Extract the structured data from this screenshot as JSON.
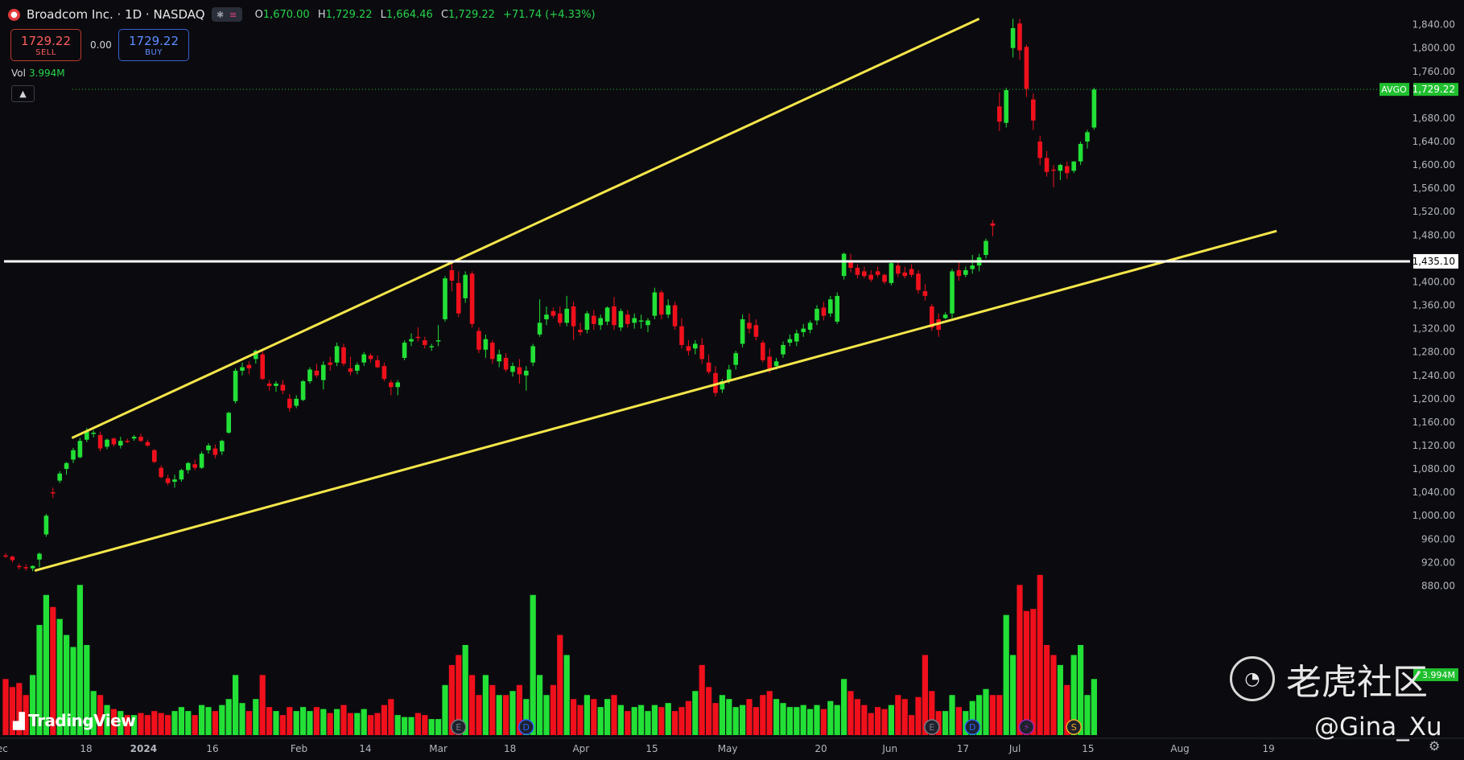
{
  "header": {
    "title": "Broadcom Inc. · 1D · NASDAQ",
    "logo_glyph": "●",
    "ohlc": [
      {
        "k": "O",
        "v": "1,670.00"
      },
      {
        "k": "H",
        "v": "1,729.22"
      },
      {
        "k": "L",
        "v": "1,664.46"
      },
      {
        "k": "C",
        "v": "1,729.22"
      }
    ],
    "change": "+71.74 (+4.33%)"
  },
  "trade": {
    "sell_price": "1729.22",
    "sell_label": "SELL",
    "spread": "0.00",
    "buy_price": "1729.22",
    "buy_label": "BUY"
  },
  "volume": {
    "label": "Vol",
    "value": "3.994M"
  },
  "branding": {
    "tradingview": "TradingView",
    "watermark": "老虎社区",
    "handle": "@Gina_Xu"
  },
  "colors": {
    "up": "#22e036",
    "down": "#f0101c",
    "trendline": "#f5e64a",
    "hline": "#ffffff",
    "price_tag": "#1fbf2e"
  },
  "chart_data": {
    "type": "candlestick",
    "symbol": "AVGO",
    "last_price": 1729.22,
    "last_price_label": "1,729.22",
    "horizontal_line": {
      "price": 1435.1,
      "label": "1,435.10"
    },
    "ylim": [
      860,
      1856
    ],
    "y_ticks": [
      880,
      920,
      960,
      1000,
      1040,
      1080,
      1120,
      1160,
      1200,
      1240,
      1280,
      1320,
      1360,
      1400,
      1480,
      1520,
      1560,
      1600,
      1640,
      1680,
      1760,
      1800,
      1840
    ],
    "y_tick_labels": [
      "880.00",
      "920.00",
      "960.00",
      "1,000.00",
      "1,040.00",
      "1,080.00",
      "1,120.00",
      "1,160.00",
      "1,200.00",
      "1,240.00",
      "1,280.00",
      "1,320.00",
      "1,360.00",
      "1,400.00",
      "1,480.00",
      "1,520.00",
      "1,560.00",
      "1,600.00",
      "1,640.00",
      "1,680.00",
      "1,760.00",
      "1,800.00",
      "1,840.00"
    ],
    "x_labels": [
      "ec",
      "18",
      "2024",
      "16",
      "Feb",
      "14",
      "Mar",
      "18",
      "Apr",
      "15",
      "May",
      "20",
      "Jun",
      "17",
      "Jul",
      "15",
      "Aug",
      "19"
    ],
    "x_label_bar_index": [
      -0.5,
      11.9,
      20.4,
      30.6,
      43.4,
      53.2,
      64.0,
      74.6,
      85.1,
      95.6,
      106.8,
      120.6,
      130.8,
      141.6,
      149.3,
      160.1,
      173.7,
      186.8
    ],
    "volume_tag": "3.994M",
    "event_markers": [
      {
        "label": "E",
        "bar": 67,
        "color": "#787b86"
      },
      {
        "label": "D",
        "bar": 77,
        "color": "#2962ff"
      },
      {
        "label": "E",
        "bar": 137,
        "color": "#787b86"
      },
      {
        "label": "D",
        "bar": 143,
        "color": "#2962ff"
      },
      {
        "label": "⚡",
        "bar": 151,
        "color": "#9c27b0"
      },
      {
        "label": "S",
        "bar": 158,
        "color": "#f5a623"
      }
    ],
    "trendlines": [
      {
        "name": "upper",
        "from": {
          "bar": 9.8,
          "price": 1133
        },
        "to": {
          "bar": 144,
          "price": 1850
        }
      },
      {
        "name": "lower",
        "from": {
          "bar": 4.3,
          "price": 906
        },
        "to": {
          "bar": 188,
          "price": 1487
        }
      }
    ],
    "candles": [
      [
        932,
        936,
        928,
        930,
        28
      ],
      [
        930,
        932,
        920,
        924,
        24
      ],
      [
        914,
        918,
        908,
        912,
        26
      ],
      [
        912,
        917,
        906,
        910,
        20
      ],
      [
        910,
        915,
        905,
        914,
        30
      ],
      [
        925,
        937,
        912,
        935,
        55
      ],
      [
        968,
        1003,
        964,
        1000,
        70
      ],
      [
        1040,
        1048,
        1030,
        1038,
        64
      ],
      [
        1060,
        1076,
        1056,
        1072,
        58
      ],
      [
        1080,
        1092,
        1070,
        1090,
        50
      ],
      [
        1096,
        1116,
        1090,
        1112,
        44
      ],
      [
        1100,
        1133,
        1098,
        1128,
        75
      ],
      [
        1130,
        1150,
        1126,
        1145,
        45
      ],
      [
        1140,
        1146,
        1134,
        1142,
        22
      ],
      [
        1138,
        1144,
        1110,
        1115,
        20
      ],
      [
        1118,
        1132,
        1114,
        1130,
        15
      ],
      [
        1132,
        1134,
        1118,
        1122,
        13
      ],
      [
        1120,
        1135,
        1115,
        1128,
        12
      ],
      [
        1128,
        1132,
        1124,
        1126,
        10
      ],
      [
        1132,
        1138,
        1128,
        1135,
        10
      ],
      [
        1135,
        1140,
        1126,
        1128,
        11
      ],
      [
        1126,
        1130,
        1118,
        1120,
        10
      ],
      [
        1112,
        1114,
        1090,
        1092,
        12
      ],
      [
        1082,
        1086,
        1064,
        1066,
        11
      ],
      [
        1064,
        1070,
        1052,
        1056,
        10
      ],
      [
        1058,
        1070,
        1048,
        1062,
        12
      ],
      [
        1062,
        1080,
        1058,
        1078,
        14
      ],
      [
        1078,
        1092,
        1072,
        1090,
        12
      ],
      [
        1088,
        1096,
        1078,
        1082,
        10
      ],
      [
        1082,
        1110,
        1080,
        1106,
        15
      ],
      [
        1112,
        1124,
        1106,
        1120,
        14
      ],
      [
        1115,
        1122,
        1098,
        1104,
        12
      ],
      [
        1110,
        1130,
        1104,
        1128,
        15
      ],
      [
        1142,
        1178,
        1140,
        1176,
        18
      ],
      [
        1196,
        1252,
        1192,
        1248,
        30
      ],
      [
        1248,
        1262,
        1240,
        1254,
        16
      ],
      [
        1258,
        1264,
        1242,
        1252,
        12
      ],
      [
        1268,
        1284,
        1260,
        1282,
        18
      ],
      [
        1276,
        1286,
        1232,
        1234,
        30
      ],
      [
        1226,
        1232,
        1214,
        1222,
        14
      ],
      [
        1222,
        1230,
        1212,
        1226,
        12
      ],
      [
        1224,
        1232,
        1208,
        1214,
        10
      ],
      [
        1200,
        1208,
        1178,
        1184,
        14
      ],
      [
        1188,
        1206,
        1184,
        1200,
        12
      ],
      [
        1198,
        1232,
        1196,
        1230,
        14
      ],
      [
        1230,
        1254,
        1226,
        1250,
        12
      ],
      [
        1248,
        1260,
        1236,
        1240,
        14
      ],
      [
        1232,
        1264,
        1216,
        1258,
        13
      ],
      [
        1262,
        1272,
        1248,
        1258,
        11
      ],
      [
        1262,
        1296,
        1256,
        1290,
        13
      ],
      [
        1288,
        1294,
        1256,
        1260,
        15
      ],
      [
        1252,
        1272,
        1240,
        1246,
        11
      ],
      [
        1248,
        1262,
        1242,
        1258,
        11
      ],
      [
        1262,
        1280,
        1256,
        1276,
        13
      ],
      [
        1274,
        1278,
        1262,
        1268,
        10
      ],
      [
        1266,
        1274,
        1252,
        1254,
        11
      ],
      [
        1256,
        1262,
        1230,
        1234,
        15
      ],
      [
        1228,
        1232,
        1206,
        1220,
        18
      ],
      [
        1220,
        1232,
        1206,
        1228,
        10
      ],
      [
        1270,
        1300,
        1266,
        1296,
        9
      ],
      [
        1298,
        1312,
        1290,
        1302,
        9
      ],
      [
        1306,
        1322,
        1298,
        1304,
        11
      ],
      [
        1300,
        1306,
        1286,
        1292,
        10
      ],
      [
        1288,
        1294,
        1282,
        1290,
        8
      ],
      [
        1298,
        1326,
        1290,
        1300,
        8
      ],
      [
        1336,
        1410,
        1332,
        1406,
        25
      ],
      [
        1420,
        1436,
        1384,
        1402,
        35
      ],
      [
        1398,
        1418,
        1340,
        1346,
        40
      ],
      [
        1372,
        1418,
        1364,
        1412,
        45
      ],
      [
        1414,
        1418,
        1322,
        1328,
        30
      ],
      [
        1316,
        1322,
        1278,
        1284,
        20
      ],
      [
        1284,
        1310,
        1270,
        1302,
        30
      ],
      [
        1296,
        1300,
        1260,
        1268,
        25
      ],
      [
        1264,
        1284,
        1254,
        1276,
        20
      ],
      [
        1270,
        1278,
        1246,
        1250,
        20
      ],
      [
        1246,
        1262,
        1238,
        1256,
        22
      ],
      [
        1254,
        1268,
        1226,
        1242,
        25
      ],
      [
        1240,
        1256,
        1214,
        1248,
        18
      ],
      [
        1262,
        1294,
        1256,
        1290,
        70
      ],
      [
        1310,
        1370,
        1306,
        1330,
        30
      ],
      [
        1336,
        1358,
        1326,
        1344,
        20
      ],
      [
        1350,
        1356,
        1338,
        1342,
        25
      ],
      [
        1346,
        1358,
        1324,
        1330,
        50
      ],
      [
        1330,
        1376,
        1324,
        1354,
        40
      ],
      [
        1358,
        1366,
        1300,
        1324,
        18
      ],
      [
        1318,
        1330,
        1308,
        1314,
        15
      ],
      [
        1318,
        1350,
        1312,
        1346,
        20
      ],
      [
        1342,
        1352,
        1318,
        1328,
        18
      ],
      [
        1326,
        1344,
        1318,
        1338,
        14
      ],
      [
        1332,
        1358,
        1326,
        1356,
        18
      ],
      [
        1358,
        1374,
        1318,
        1326,
        20
      ],
      [
        1322,
        1354,
        1316,
        1350,
        15
      ],
      [
        1344,
        1352,
        1322,
        1328,
        12
      ],
      [
        1330,
        1346,
        1320,
        1338,
        14
      ],
      [
        1332,
        1344,
        1320,
        1334,
        15
      ],
      [
        1326,
        1338,
        1314,
        1334,
        12
      ],
      [
        1342,
        1390,
        1336,
        1382,
        15
      ],
      [
        1382,
        1386,
        1336,
        1344,
        14
      ],
      [
        1344,
        1370,
        1338,
        1360,
        16
      ],
      [
        1360,
        1366,
        1318,
        1324,
        12
      ],
      [
        1324,
        1338,
        1286,
        1292,
        14
      ],
      [
        1290,
        1300,
        1274,
        1282,
        17
      ],
      [
        1286,
        1300,
        1276,
        1294,
        22
      ],
      [
        1292,
        1304,
        1260,
        1268,
        35
      ],
      [
        1262,
        1276,
        1242,
        1246,
        24
      ],
      [
        1244,
        1256,
        1204,
        1210,
        16
      ],
      [
        1216,
        1234,
        1210,
        1230,
        20
      ],
      [
        1232,
        1258,
        1226,
        1250,
        18
      ],
      [
        1258,
        1282,
        1250,
        1278,
        14
      ],
      [
        1294,
        1344,
        1288,
        1336,
        15
      ],
      [
        1330,
        1346,
        1312,
        1320,
        18
      ],
      [
        1326,
        1336,
        1300,
        1306,
        14
      ],
      [
        1296,
        1300,
        1262,
        1266,
        20
      ],
      [
        1272,
        1286,
        1244,
        1250,
        22
      ],
      [
        1256,
        1270,
        1250,
        1264,
        18
      ],
      [
        1276,
        1298,
        1270,
        1292,
        16
      ],
      [
        1296,
        1310,
        1290,
        1302,
        14
      ],
      [
        1298,
        1318,
        1290,
        1312,
        14
      ],
      [
        1314,
        1328,
        1306,
        1320,
        15
      ],
      [
        1318,
        1334,
        1312,
        1330,
        13
      ],
      [
        1334,
        1360,
        1326,
        1354,
        15
      ],
      [
        1356,
        1366,
        1334,
        1342,
        13
      ],
      [
        1346,
        1376,
        1340,
        1370,
        17
      ],
      [
        1332,
        1382,
        1328,
        1376,
        15
      ],
      [
        1410,
        1450,
        1404,
        1448,
        28
      ],
      [
        1436,
        1448,
        1416,
        1424,
        22
      ],
      [
        1424,
        1430,
        1406,
        1412,
        18
      ],
      [
        1418,
        1426,
        1406,
        1410,
        15
      ],
      [
        1412,
        1420,
        1400,
        1404,
        11
      ],
      [
        1418,
        1426,
        1408,
        1412,
        14
      ],
      [
        1412,
        1414,
        1396,
        1400,
        13
      ],
      [
        1398,
        1436,
        1394,
        1432,
        15
      ],
      [
        1428,
        1434,
        1408,
        1414,
        20
      ],
      [
        1416,
        1426,
        1406,
        1410,
        18
      ],
      [
        1422,
        1430,
        1408,
        1412,
        10
      ],
      [
        1414,
        1420,
        1380,
        1386,
        19
      ],
      [
        1384,
        1396,
        1368,
        1376,
        40
      ],
      [
        1358,
        1362,
        1316,
        1322,
        22
      ],
      [
        1336,
        1346,
        1306,
        1318,
        12
      ],
      [
        1338,
        1348,
        1336,
        1344,
        12
      ],
      [
        1346,
        1422,
        1338,
        1418,
        20
      ],
      [
        1420,
        1434,
        1402,
        1410,
        14
      ],
      [
        1412,
        1426,
        1408,
        1420,
        12
      ],
      [
        1422,
        1446,
        1414,
        1428,
        17
      ],
      [
        1428,
        1448,
        1418,
        1442,
        20
      ],
      [
        1446,
        1474,
        1440,
        1470,
        23
      ],
      [
        1500,
        1506,
        1478,
        1496,
        20
      ],
      [
        1700,
        1724,
        1658,
        1674,
        20
      ],
      [
        1672,
        1732,
        1664,
        1728,
        60
      ],
      [
        1800,
        1850,
        1784,
        1834,
        40
      ],
      [
        1842,
        1850,
        1780,
        1796,
        75
      ],
      [
        1802,
        1806,
        1716,
        1730,
        62
      ],
      [
        1712,
        1722,
        1660,
        1676,
        63
      ],
      [
        1640,
        1650,
        1600,
        1612,
        80
      ],
      [
        1612,
        1624,
        1580,
        1588,
        45
      ],
      [
        1592,
        1600,
        1562,
        1590,
        40
      ],
      [
        1590,
        1602,
        1574,
        1600,
        35
      ],
      [
        1598,
        1606,
        1576,
        1586,
        25
      ],
      [
        1590,
        1606,
        1586,
        1606,
        40
      ],
      [
        1606,
        1640,
        1600,
        1636,
        45
      ],
      [
        1640,
        1660,
        1628,
        1656,
        20
      ],
      [
        1664,
        1732,
        1660,
        1729,
        28
      ]
    ]
  }
}
